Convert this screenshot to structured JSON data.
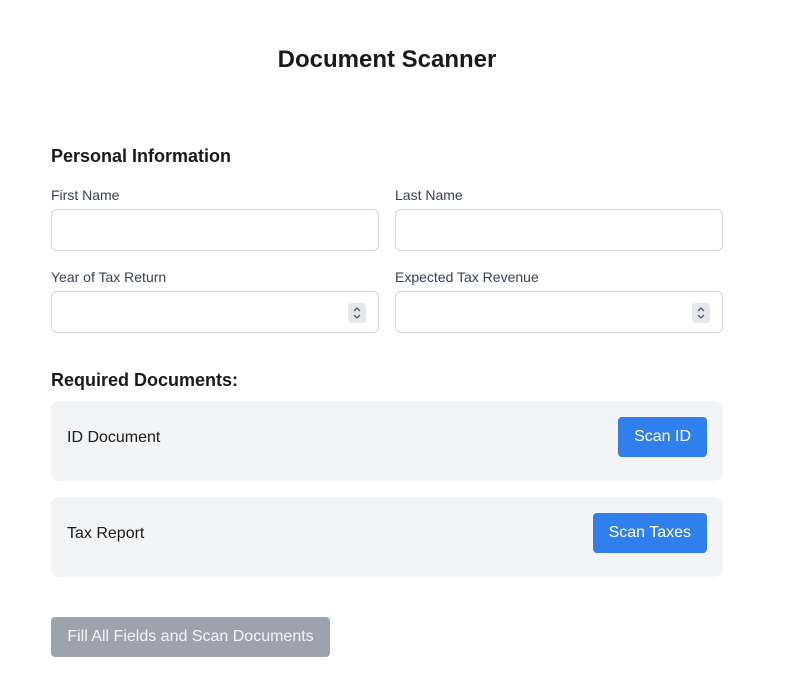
{
  "page": {
    "title": "Document Scanner"
  },
  "personal": {
    "heading": "Personal Information",
    "first_name_label": "First Name",
    "first_name_value": "",
    "last_name_label": "Last Name",
    "last_name_value": "",
    "tax_year_label": "Year of Tax Return",
    "tax_year_value": "",
    "expected_revenue_label": "Expected Tax Revenue",
    "expected_revenue_value": ""
  },
  "documents": {
    "heading": "Required Documents:",
    "items": [
      {
        "label": "ID Document",
        "button_label": "Scan ID"
      },
      {
        "label": "Tax Report",
        "button_label": "Scan Taxes"
      }
    ]
  },
  "submit": {
    "label": "Fill All Fields and Scan Documents",
    "disabled": true
  },
  "colors": {
    "primary_button": "#2f80ed",
    "disabled_button": "#9ca3af",
    "card_background": "#f3f4f6"
  },
  "icons": {
    "number_spinner": "chevron-up-down-icon"
  }
}
